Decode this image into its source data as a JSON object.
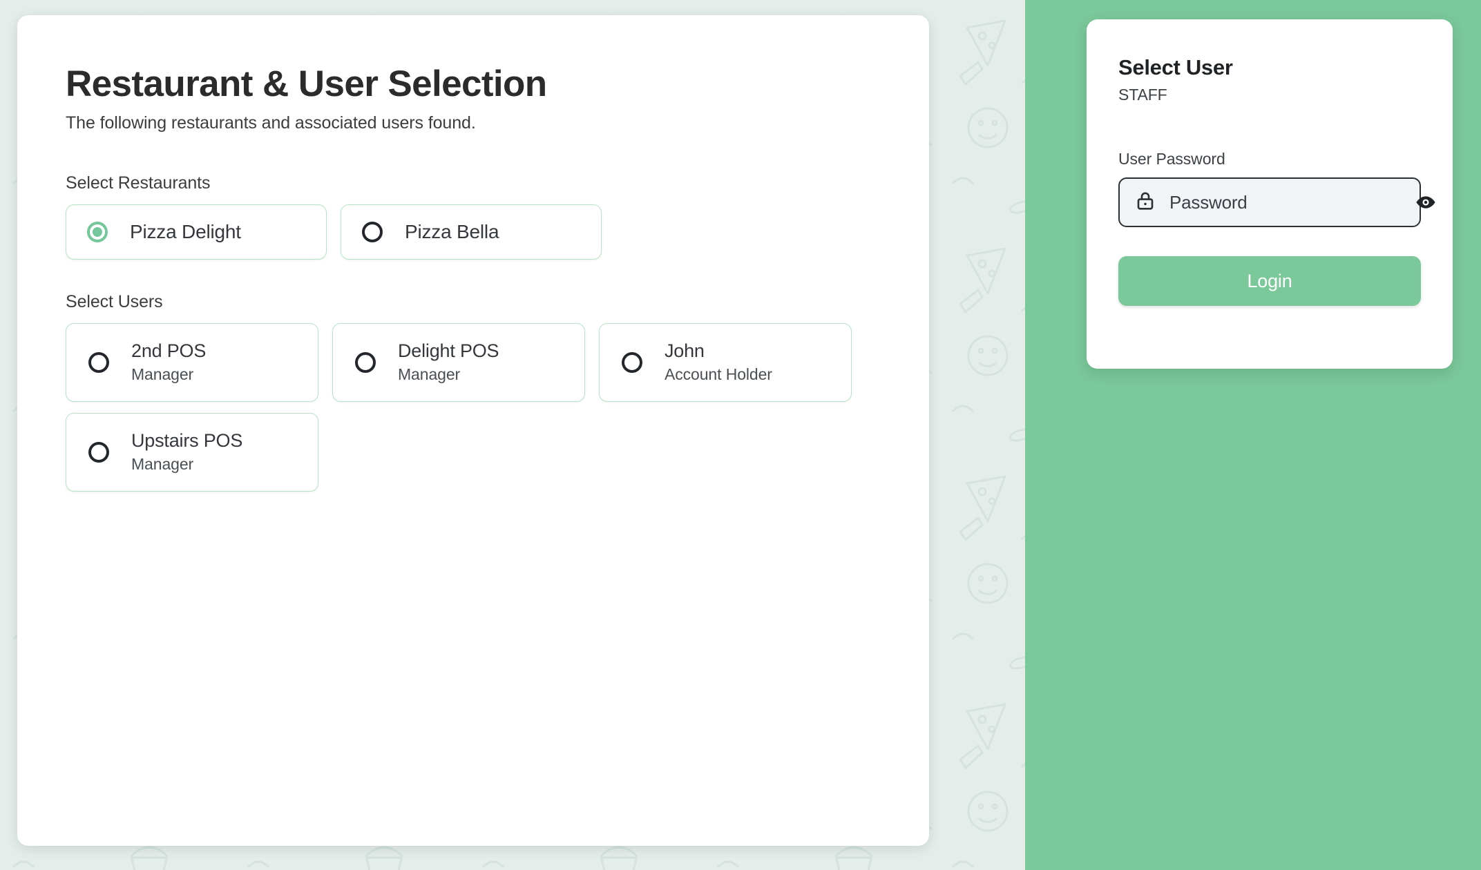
{
  "theme": {
    "background_color": "#E4EDEA",
    "accent_green": "#7BC89A",
    "card_border_green": "#B7E3C6",
    "input_fill": "#F1F3F7",
    "text_dark": "#2B2B2B"
  },
  "main": {
    "title": "Restaurant & User Selection",
    "subtitle": "The following restaurants and associated users found.",
    "restaurants": {
      "label": "Select Restaurants",
      "options": [
        {
          "name": "Pizza Delight",
          "selected": true
        },
        {
          "name": "Pizza Bella",
          "selected": false
        }
      ]
    },
    "users": {
      "label": "Select Users",
      "options": [
        {
          "name": "2nd POS",
          "role": "Manager",
          "selected": false
        },
        {
          "name": "Delight POS",
          "role": "Manager",
          "selected": false
        },
        {
          "name": "John",
          "role": "Account Holder",
          "selected": false
        },
        {
          "name": "Upstairs POS",
          "role": "Manager",
          "selected": false
        }
      ]
    }
  },
  "login": {
    "title": "Select User",
    "subtitle": "STAFF",
    "password_label": "User Password",
    "password_placeholder": "Password",
    "password_value": "",
    "lock_icon": "lock-icon",
    "visibility_icon": "eye-icon",
    "button_label": "Login"
  }
}
